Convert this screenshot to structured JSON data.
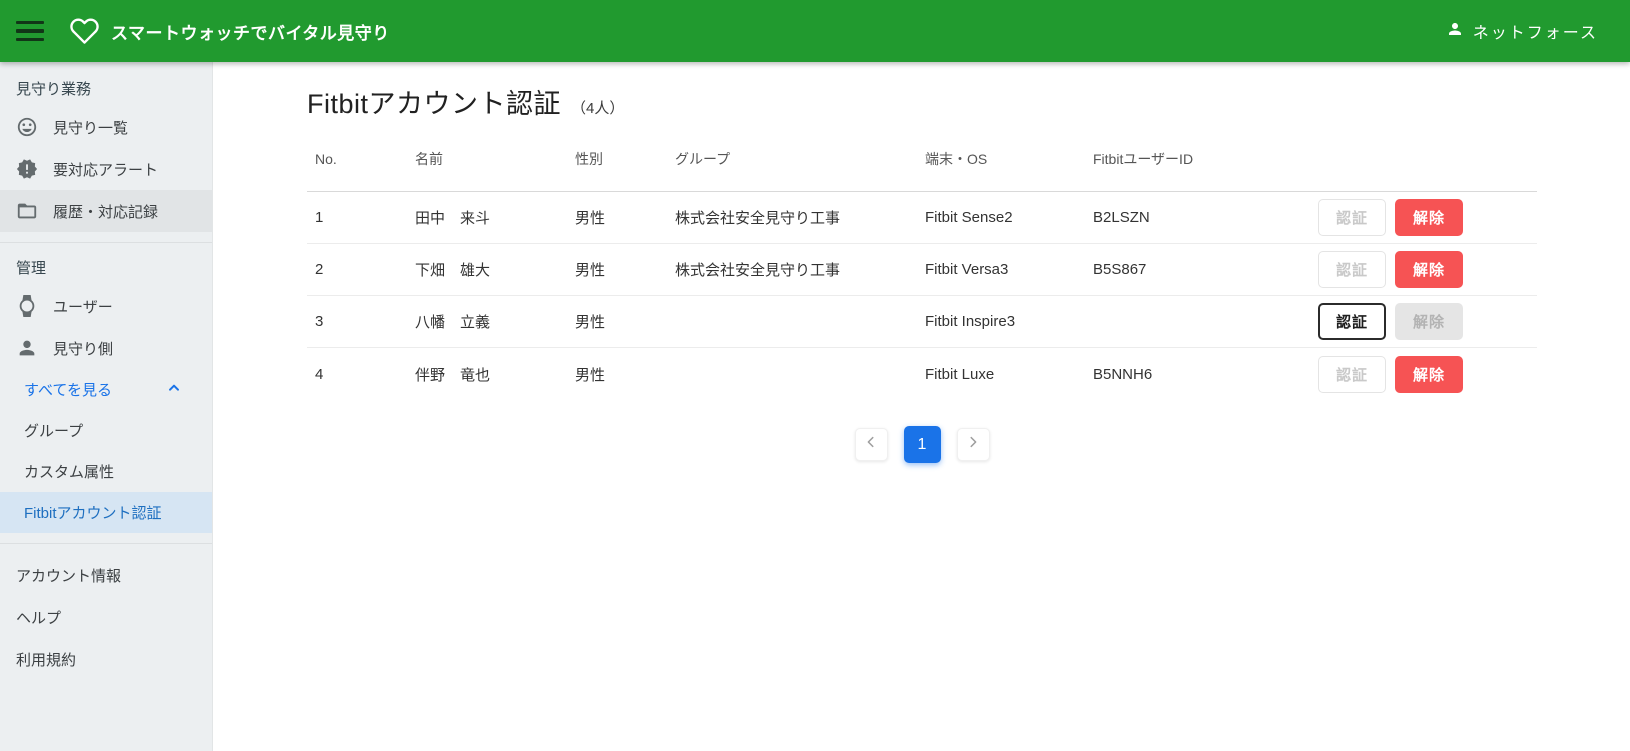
{
  "header": {
    "title": "スマートウォッチでバイタル見守り",
    "user_name": "ネットフォース"
  },
  "sidebar": {
    "sections": [
      {
        "title": "見守り業務",
        "items": [
          {
            "label": "見守り一覧",
            "icon": "smiley-icon"
          },
          {
            "label": "要対応アラート",
            "icon": "alert-badge-icon"
          },
          {
            "label": "履歴・対応記録",
            "icon": "folder-icon",
            "state": "highlighted"
          }
        ]
      },
      {
        "title": "管理",
        "items": [
          {
            "label": "ユーザー",
            "icon": "watch-icon"
          },
          {
            "label": "見守り側",
            "icon": "person-icon"
          },
          {
            "label": "すべてを見る",
            "icon": "chevron-up-icon",
            "state": "expanded-link"
          },
          {
            "label": "グループ"
          },
          {
            "label": "カスタム属性"
          },
          {
            "label": "Fitbitアカウント認証",
            "state": "selected"
          }
        ]
      },
      {
        "title": "",
        "items": [
          {
            "label": "アカウント情報"
          },
          {
            "label": "ヘルプ"
          },
          {
            "label": "利用規約"
          }
        ]
      }
    ]
  },
  "main": {
    "title": "Fitbitアカウント認証",
    "count": "（4人）",
    "table": {
      "headers": {
        "no": "No.",
        "name": "名前",
        "gender": "性別",
        "group": "グループ",
        "device": "端末・OS",
        "fitbit_id": "FitbitユーザーID"
      },
      "auth_label": "認証",
      "release_label": "解除",
      "rows": [
        {
          "no": "1",
          "name": "田中　来斗",
          "gender": "男性",
          "group": "株式会社安全見守り工事",
          "device": "Fitbit Sense2",
          "fitbit_id": "B2LSZN",
          "auth_state": "disabled",
          "release_state": "enabled"
        },
        {
          "no": "2",
          "name": "下畑　雄大",
          "gender": "男性",
          "group": "株式会社安全見守り工事",
          "device": "Fitbit Versa3",
          "fitbit_id": "B5S867",
          "auth_state": "disabled",
          "release_state": "enabled"
        },
        {
          "no": "3",
          "name": "八幡　立義",
          "gender": "男性",
          "group": "",
          "device": "Fitbit Inspire3",
          "fitbit_id": "",
          "auth_state": "enabled",
          "release_state": "disabled"
        },
        {
          "no": "4",
          "name": "伴野　竜也",
          "gender": "男性",
          "group": "",
          "device": "Fitbit Luxe",
          "fitbit_id": "B5NNH6",
          "auth_state": "disabled",
          "release_state": "enabled"
        }
      ]
    },
    "pagination": {
      "current_page": "1"
    }
  },
  "colors": {
    "header_green": "#219a2f",
    "accent_blue": "#1a73e8",
    "danger_red": "#f65354"
  }
}
